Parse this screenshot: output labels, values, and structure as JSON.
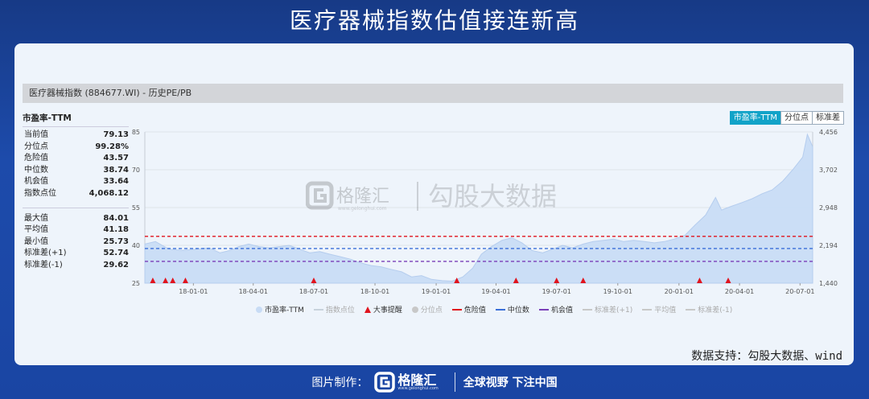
{
  "page_title": "医疗器械指数估值接连新高",
  "panel_title": "医疗器械指数 (884677.WI) - 历史PE/PB",
  "stats": {
    "title": "市盈率-TTM",
    "rows_top": [
      {
        "label": "当前值",
        "value": "79.13"
      },
      {
        "label": "分位点",
        "value": "99.28%"
      },
      {
        "label": "危险值",
        "value": "43.57"
      },
      {
        "label": "中位数",
        "value": "38.74"
      },
      {
        "label": "机会值",
        "value": "33.64"
      },
      {
        "label": "指数点位",
        "value": "4,068.12"
      }
    ],
    "rows_bottom": [
      {
        "label": "最大值",
        "value": "84.01"
      },
      {
        "label": "平均值",
        "value": "41.18"
      },
      {
        "label": "最小值",
        "value": "25.73"
      },
      {
        "label": "标准差(+1)",
        "value": "52.74"
      },
      {
        "label": "标准差(-1)",
        "value": "29.62"
      }
    ]
  },
  "tabs": [
    {
      "label": "市盈率-TTM",
      "active": true
    },
    {
      "label": "分位点",
      "active": false
    },
    {
      "label": "标准差",
      "active": false
    }
  ],
  "watermark": {
    "logo_text": "格隆汇",
    "logo_sub": "www.gelonghui.com",
    "text": "勾股大数据"
  },
  "source": "数据支持：勾股大数据、wind",
  "legend": [
    {
      "label": "市盈率-TTM",
      "shape": "dot",
      "color": "#c8dcf5",
      "muted": false
    },
    {
      "label": "指数点位",
      "shape": "line",
      "color": "#c8d2dc",
      "muted": true
    },
    {
      "label": "大事提醒",
      "shape": "tri",
      "color": "#e0141e",
      "muted": false
    },
    {
      "label": "分位点",
      "shape": "dot",
      "color": "#c8c8c8",
      "muted": true
    },
    {
      "label": "危险值",
      "shape": "dash",
      "color": "#e0141e",
      "muted": false
    },
    {
      "label": "中位数",
      "shape": "dash",
      "color": "#3a6fd8",
      "muted": false
    },
    {
      "label": "机会值",
      "shape": "dash",
      "color": "#7a3fb8",
      "muted": false
    },
    {
      "label": "标准差(+1)",
      "shape": "dash",
      "color": "#c8c8c8",
      "muted": true
    },
    {
      "label": "平均值",
      "shape": "dash",
      "color": "#c8c8c8",
      "muted": true
    },
    {
      "label": "标准差(-1)",
      "shape": "dash",
      "color": "#c8c8c8",
      "muted": true
    }
  ],
  "footer": {
    "credit_label": "图片制作：",
    "brand": "格隆汇",
    "brand_sub": "www.gelonghui.com",
    "slogan": "全球视野 下注中国"
  },
  "chart_data": {
    "type": "area",
    "x_ticks": [
      "18-01-01",
      "18-04-01",
      "18-07-01",
      "18-10-01",
      "19-01-01",
      "19-04-01",
      "19-07-01",
      "19-10-01",
      "20-01-01",
      "20-04-01",
      "20-07-01"
    ],
    "x_tick_dates": [
      "2018-01-01",
      "2018-04-01",
      "2018-07-01",
      "2018-10-01",
      "2019-01-01",
      "2019-04-01",
      "2019-07-01",
      "2019-10-01",
      "2020-01-01",
      "2020-04-01",
      "2020-07-01"
    ],
    "x_range": [
      "2017-10-20",
      "2020-07-20"
    ],
    "y_left_ticks": [
      "85",
      "70",
      "55",
      "40",
      "25"
    ],
    "y_left_range": [
      25,
      85
    ],
    "y_right_ticks": [
      "4,456",
      "3,702",
      "2,948",
      "2,194",
      "1,440"
    ],
    "y_right_range": [
      1440,
      4456
    ],
    "grid": true,
    "series": [
      {
        "name": "市盈率-TTM",
        "color": "#c8dcf5",
        "points": [
          [
            "2017-10-20",
            40.5
          ],
          [
            "2017-11-05",
            41.5
          ],
          [
            "2017-11-25",
            38.5
          ],
          [
            "2017-12-15",
            38.0
          ],
          [
            "2018-01-05",
            38.5
          ],
          [
            "2018-01-25",
            39.0
          ],
          [
            "2018-02-10",
            37.0
          ],
          [
            "2018-02-25",
            38.0
          ],
          [
            "2018-03-10",
            39.5
          ],
          [
            "2018-03-25",
            40.5
          ],
          [
            "2018-04-10",
            39.5
          ],
          [
            "2018-04-25",
            39.0
          ],
          [
            "2018-05-10",
            39.5
          ],
          [
            "2018-05-25",
            40.0
          ],
          [
            "2018-06-10",
            38.5
          ],
          [
            "2018-06-25",
            37.0
          ],
          [
            "2018-07-10",
            37.5
          ],
          [
            "2018-07-25",
            36.5
          ],
          [
            "2018-08-10",
            35.5
          ],
          [
            "2018-08-25",
            34.5
          ],
          [
            "2018-09-10",
            33.0
          ],
          [
            "2018-09-25",
            32.0
          ],
          [
            "2018-10-10",
            31.5
          ],
          [
            "2018-10-25",
            30.5
          ],
          [
            "2018-11-10",
            29.5
          ],
          [
            "2018-11-25",
            27.5
          ],
          [
            "2018-12-10",
            28.0
          ],
          [
            "2018-12-25",
            26.5
          ],
          [
            "2019-01-10",
            26.0
          ],
          [
            "2019-01-25",
            25.8
          ],
          [
            "2019-02-10",
            27.5
          ],
          [
            "2019-02-25",
            31.0
          ],
          [
            "2019-03-10",
            36.5
          ],
          [
            "2019-03-25",
            39.5
          ],
          [
            "2019-04-10",
            42.0
          ],
          [
            "2019-04-25",
            43.0
          ],
          [
            "2019-05-10",
            41.0
          ],
          [
            "2019-05-25",
            38.0
          ],
          [
            "2019-06-10",
            37.0
          ],
          [
            "2019-06-25",
            38.5
          ],
          [
            "2019-07-10",
            40.0
          ],
          [
            "2019-07-25",
            39.0
          ],
          [
            "2019-08-10",
            40.5
          ],
          [
            "2019-08-25",
            41.5
          ],
          [
            "2019-09-10",
            42.0
          ],
          [
            "2019-09-25",
            42.5
          ],
          [
            "2019-10-10",
            41.5
          ],
          [
            "2019-10-25",
            42.0
          ],
          [
            "2019-11-10",
            41.5
          ],
          [
            "2019-11-25",
            41.0
          ],
          [
            "2019-12-10",
            41.5
          ],
          [
            "2019-12-25",
            42.5
          ],
          [
            "2020-01-10",
            44.0
          ],
          [
            "2020-01-25",
            48.0
          ],
          [
            "2020-02-10",
            52.0
          ],
          [
            "2020-02-25",
            59.0
          ],
          [
            "2020-03-05",
            54.0
          ],
          [
            "2020-03-20",
            55.5
          ],
          [
            "2020-04-05",
            57.0
          ],
          [
            "2020-04-20",
            58.5
          ],
          [
            "2020-05-05",
            60.5
          ],
          [
            "2020-05-20",
            62.0
          ],
          [
            "2020-06-05",
            65.5
          ],
          [
            "2020-06-20",
            70.0
          ],
          [
            "2020-07-05",
            75.0
          ],
          [
            "2020-07-12",
            84.0
          ],
          [
            "2020-07-20",
            79.1
          ]
        ]
      }
    ],
    "reference_lines": [
      {
        "name": "危险值",
        "value": 43.57,
        "color": "#e0141e"
      },
      {
        "name": "中位数",
        "value": 38.74,
        "color": "#3a6fd8"
      },
      {
        "name": "机会值",
        "value": 33.64,
        "color": "#7a3fb8"
      }
    ],
    "events": [
      "2017-11-01",
      "2017-11-20",
      "2017-12-01",
      "2017-12-20",
      "2018-07-01",
      "2019-02-01",
      "2019-05-01",
      "2019-07-01",
      "2019-08-10",
      "2020-02-01",
      "2020-03-15"
    ]
  }
}
